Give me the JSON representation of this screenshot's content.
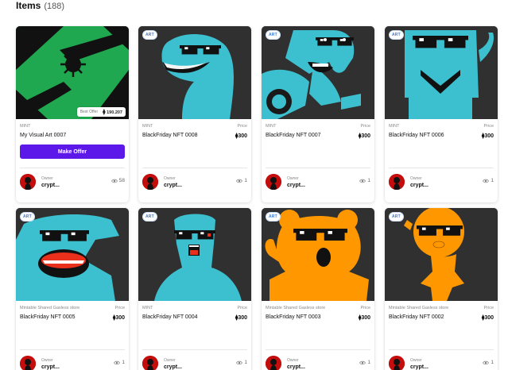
{
  "header": {
    "title": "Items",
    "count": "(188)"
  },
  "colors": {
    "accent": "#5b18e8",
    "cyan": "#3cbfcf",
    "orange": "#ff9800",
    "green": "#1fa84f"
  },
  "cards": [
    {
      "badge": "",
      "category": "MINT",
      "name": "My Visual Art 0007",
      "price_label": "",
      "price": "",
      "best_offer_label": "Best Offer",
      "best_offer_value": "190.207",
      "button": "Make Offer",
      "owner_label": "Owner",
      "owner_name": "crypt...",
      "views": "58",
      "art": "green-abstract"
    },
    {
      "badge": "ART",
      "category": "MINT",
      "name": "BlackFriday NFT 0008",
      "price_label": "Price",
      "price": "300",
      "owner_label": "Owner",
      "owner_name": "crypt...",
      "views": "1",
      "art": "cyan-bird"
    },
    {
      "badge": "ART",
      "category": "MINT",
      "name": "BlackFriday NFT 0007",
      "price_label": "Price",
      "price": "300",
      "owner_label": "Owner",
      "owner_name": "crypt...",
      "views": "1",
      "art": "cyan-rider"
    },
    {
      "badge": "ART",
      "category": "MINT",
      "name": "BlackFriday NFT 0006",
      "price_label": "Price",
      "price": "300",
      "owner_label": "Owner",
      "owner_name": "crypt...",
      "views": "1",
      "art": "cyan-sponge"
    },
    {
      "badge": "ART",
      "category": "Mintable Shared Gasless store",
      "name": "BlackFriday NFT 0005",
      "price_label": "Price",
      "price": "300",
      "owner_label": "Owner",
      "owner_name": "crypt...",
      "views": "1",
      "art": "cyan-shout"
    },
    {
      "badge": "ART",
      "category": "MINT",
      "name": "BlackFriday NFT 0004",
      "price_label": "Price",
      "price": "300",
      "owner_label": "Owner",
      "owner_name": "crypt...",
      "views": "1",
      "art": "cyan-man"
    },
    {
      "badge": "ART",
      "category": "Mintable Shared Gasless store",
      "name": "BlackFriday NFT 0003",
      "price_label": "Price",
      "price": "300",
      "owner_label": "Owner",
      "owner_name": "crypt...",
      "views": "1",
      "art": "orange-bear"
    },
    {
      "badge": "ART",
      "category": "Mintable Shared Gasless store",
      "name": "BlackFriday NFT 0002",
      "price_label": "Price",
      "price": "300",
      "owner_label": "Owner",
      "owner_name": "crypt...",
      "views": "1",
      "art": "orange-bird"
    }
  ]
}
